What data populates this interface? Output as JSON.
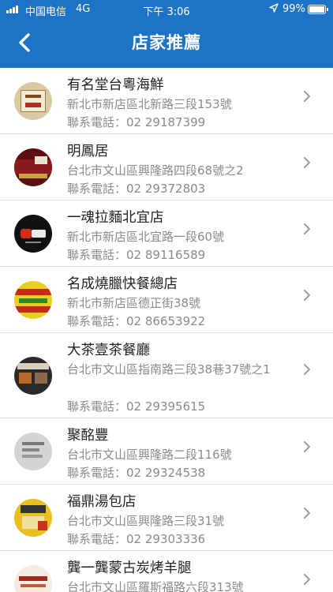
{
  "status_bar": {
    "carrier": "中国电信",
    "network": "4G",
    "time": "下午 3:06",
    "battery": "99%"
  },
  "header": {
    "title": "店家推薦"
  },
  "stores": [
    {
      "name": "有名堂台粵海鮮",
      "address": "新北市新店區北新路三段153號",
      "phone": "聯系電話：02 29187399"
    },
    {
      "name": "明鳳居",
      "address": "台北市文山區興隆路四段68號之2",
      "phone": "聯系電話：02 29372803"
    },
    {
      "name": "一魂拉麵北宜店",
      "address": "新北市新店區北宜路一段60號",
      "phone": "聯系電話：02 89116589"
    },
    {
      "name": "名成燒臘快餐總店",
      "address": "新北市新店區德正街38號",
      "phone": "聯系電話：02 86653922"
    },
    {
      "name": "大茶壹茶餐廳",
      "address": "台北市文山區指南路三段38巷37號之1",
      "phone": "聯系電話：02 29395615"
    },
    {
      "name": "聚酩豐",
      "address": "台北市文山區興隆路二段116號",
      "phone": "聯系電話：02 29324538"
    },
    {
      "name": "福鼎湯包店",
      "address": "台北市文山區興隆路三段31號",
      "phone": "聯系電話：02 29303336"
    },
    {
      "name": "龔一龔蒙古炭烤羊腿",
      "address": "台北市文山區羅斯福路六段313號",
      "phone": ""
    }
  ]
}
